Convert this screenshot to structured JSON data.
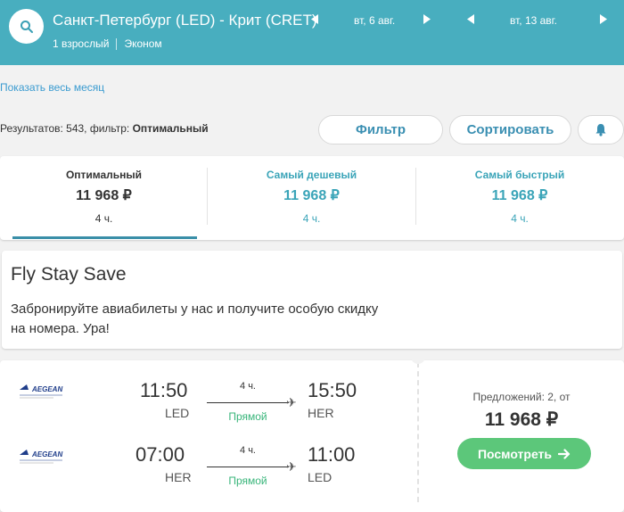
{
  "header": {
    "route": "Санкт-Петербург (LED) - Крит (CRET)",
    "passengers": "1 взрослый",
    "cabin": "Эконом",
    "depart_date": "вт, 6 авг.",
    "return_date": "вт, 13 авг."
  },
  "links": {
    "show_month": "Показать весь месяц"
  },
  "results": {
    "prefix": "Результатов: 543, фильтр: ",
    "filter_name": "Оптимальный"
  },
  "controls": {
    "filter": "Фильтр",
    "sort": "Сортировать"
  },
  "tabs": [
    {
      "label": "Оптимальный",
      "price": "11 968 ₽",
      "duration": "4 ч."
    },
    {
      "label": "Самый дешевый",
      "price": "11 968 ₽",
      "duration": "4 ч."
    },
    {
      "label": "Самый быстрый",
      "price": "11 968 ₽",
      "duration": "4 ч."
    }
  ],
  "promo": {
    "title": "Fly Stay Save",
    "text": "Забронируйте авиабилеты у нас и получите особую скидку на номера. Ура!"
  },
  "ticket": {
    "legs": [
      {
        "airline": "AEGEAN",
        "depart_time": "11:50",
        "depart_code": "LED",
        "duration": "4 ч.",
        "type": "Прямой",
        "arrive_time": "15:50",
        "arrive_code": "HER"
      },
      {
        "airline": "AEGEAN",
        "depart_time": "07:00",
        "depart_code": "HER",
        "duration": "4 ч.",
        "type": "Прямой",
        "arrive_time": "11:00",
        "arrive_code": "LED"
      }
    ],
    "offers": "Предложений: 2, от",
    "price": "11 968 ₽",
    "button": "Посмотреть"
  },
  "icons": {
    "search": "search-icon",
    "prev": "triangle-left-icon",
    "next": "triangle-right-icon",
    "bell": "bell-icon",
    "plane": "plane-icon",
    "arrow": "arrow-right-icon"
  },
  "colors": {
    "header_bg": "#48aebf",
    "accent_link": "#3a9bd0",
    "tab_inactive": "#3aa4b8",
    "direct": "#38b57a",
    "primary_button": "#5cc77a"
  }
}
